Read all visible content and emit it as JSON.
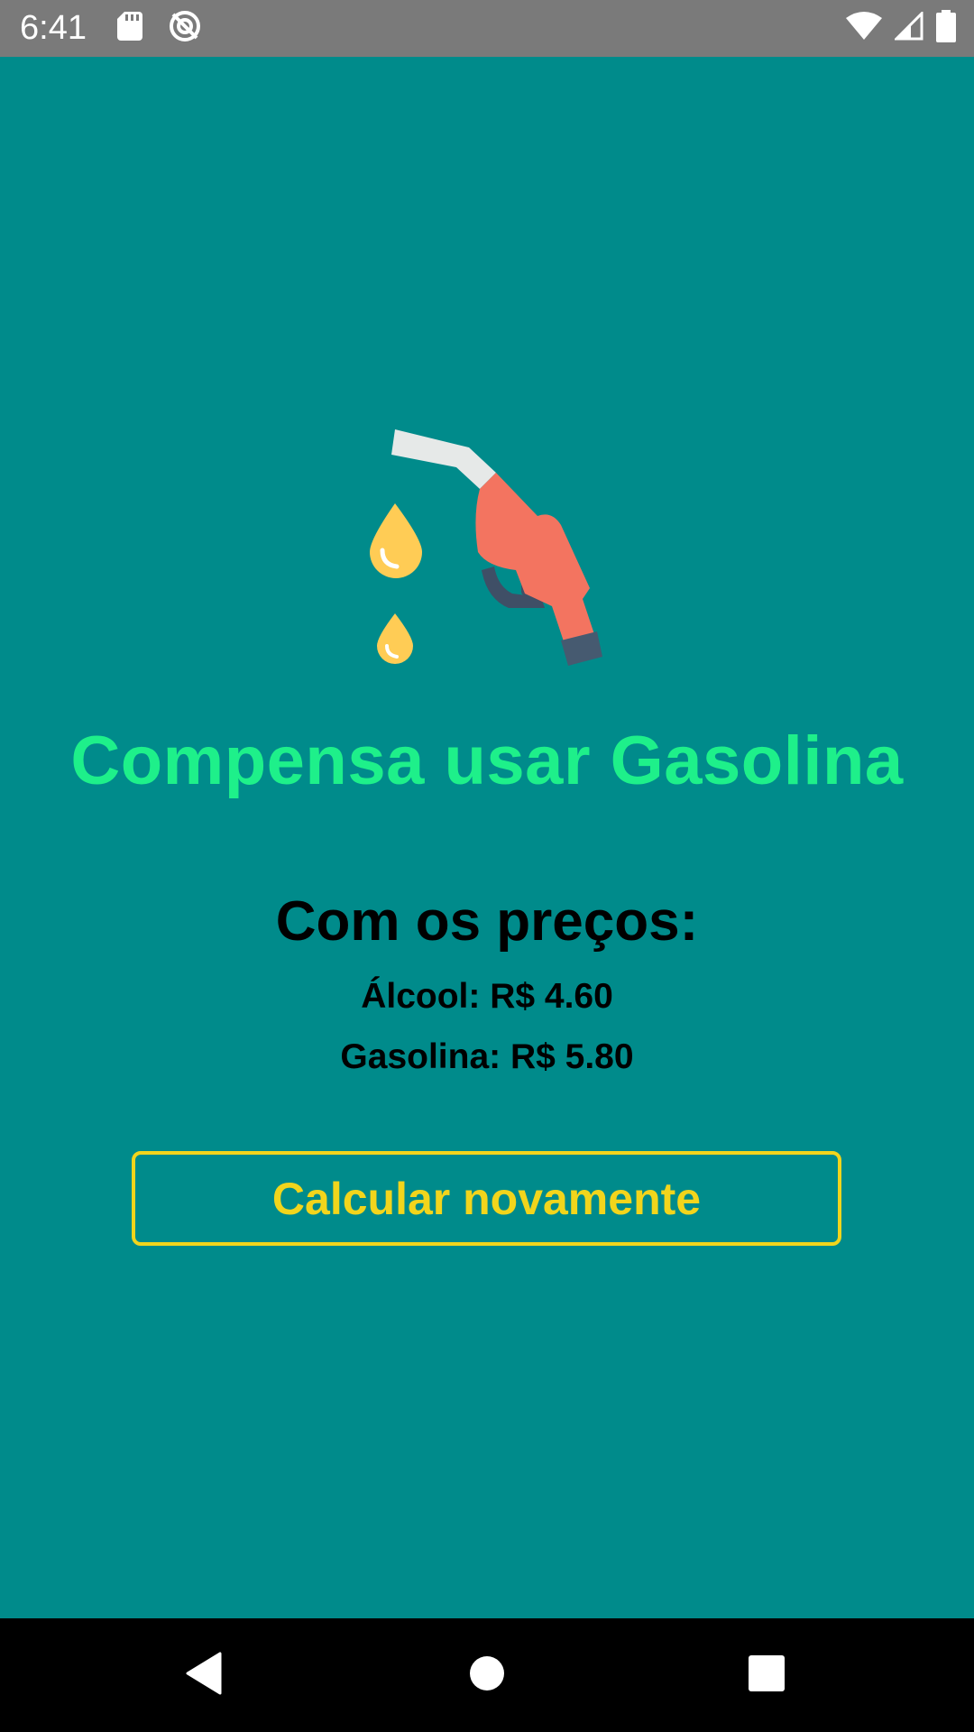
{
  "status_bar": {
    "time": "6:41",
    "left_icons": [
      "sd-card-icon",
      "sync-disabled-icon"
    ],
    "right_icons": [
      "wifi-icon",
      "cell-signal-icon",
      "battery-icon"
    ]
  },
  "result": {
    "illustration": "fuel-pump-nozzle-icon",
    "title": "Compensa usar Gasolina"
  },
  "prices": {
    "heading": "Com os preços:",
    "alcool": "Álcool: R$ 4.60",
    "gasolina": "Gasolina: R$ 5.80"
  },
  "actions": {
    "recalculate_label": "Calcular novamente"
  },
  "nav_bar": {
    "buttons": [
      "back-icon",
      "home-icon",
      "recents-icon"
    ]
  },
  "colors": {
    "background": "#008b8b",
    "title": "#1ef08a",
    "button": "#f2d51c",
    "status_bar": "#7a7a7a",
    "nav_bar": "#000000"
  }
}
